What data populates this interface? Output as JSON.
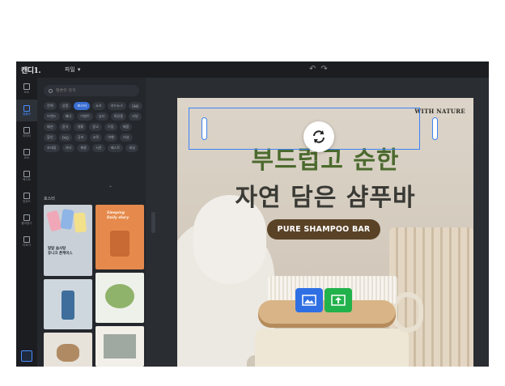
{
  "app": {
    "logo": "캔디1.",
    "file_menu": "파일"
  },
  "sidebar_rail": [
    {
      "label": "요소",
      "icon": "layout-icon"
    },
    {
      "label": "템플릿",
      "icon": "template-icon"
    },
    {
      "label": "이미지",
      "icon": "image-icon"
    },
    {
      "label": "요소",
      "icon": "elements-icon"
    },
    {
      "label": "텍스트",
      "icon": "text-icon"
    },
    {
      "label": "업로드",
      "icon": "upload-icon"
    },
    {
      "label": "즐겨찾기",
      "icon": "bookmark-icon"
    },
    {
      "label": "더보기",
      "icon": "more-icon"
    }
  ],
  "panel": {
    "search_placeholder": "템플릿 검색",
    "tags": [
      "전체",
      "상품",
      "포스터",
      "쇼츠",
      "카드뉴스",
      "SNS",
      "브랜드",
      "배너",
      "이벤트",
      "뷰티",
      "화장품",
      "리빙",
      "패션",
      "음식",
      "생활",
      "광고",
      "기업",
      "제품",
      "할인",
      "FAQ",
      "공지",
      "교육",
      "여행",
      "리뷰",
      "초대장",
      "기타",
      "채용",
      "시즌",
      "베스트",
      "세일"
    ],
    "active_tag_index": 2,
    "section_label": "포스터"
  },
  "thumbnails": [
    {
      "text": "달달 솜사탕\n유니크 폰케이스"
    },
    {
      "text": "Sleeping\nDaily diary"
    },
    {
      "text": ""
    },
    {
      "text": ""
    },
    {
      "text": ""
    },
    {
      "text": ""
    }
  ],
  "design": {
    "brand": "WITH NATURE",
    "headline_line1": "부드럽고 순한",
    "headline_line2": "자연 담은 샴푸바",
    "pill_text": "PURE SHAMPOO BAR"
  },
  "colors": {
    "accent": "#3b82f6",
    "headline_green": "#4b6a2e",
    "pill_brown": "#5a4226",
    "upload_green": "#22b24c"
  }
}
